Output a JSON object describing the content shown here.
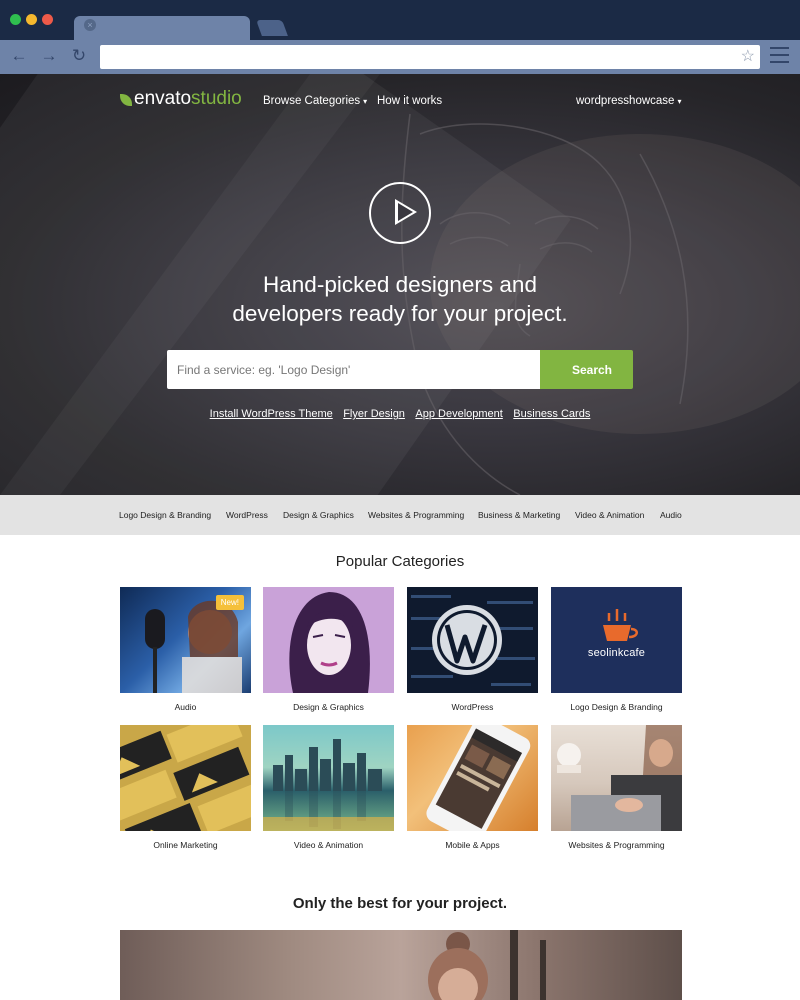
{
  "browser": {
    "tab_close_glyph": "×",
    "back_glyph": "←",
    "forward_glyph": "→",
    "reload_glyph": "↻",
    "bookmark_glyph": "☆",
    "url": ""
  },
  "header": {
    "logo_part1": "envato",
    "logo_part2": "studio",
    "nav": [
      {
        "label": "Browse Categories",
        "has_caret": true
      },
      {
        "label": "How it works",
        "has_caret": false
      }
    ],
    "account_label": "wordpresshowcase",
    "caret_glyph": "▾"
  },
  "hero": {
    "headline_line1": "Hand-picked designers and",
    "headline_line2": "developers ready for your project.",
    "search_placeholder": "Find a service: eg. 'Logo Design'",
    "search_button": "Search",
    "quick_links": [
      "Install WordPress Theme",
      "Flyer Design",
      "App Development",
      "Business Cards"
    ]
  },
  "category_bar": [
    "Logo Design & Branding",
    "WordPress",
    "Design & Graphics",
    "Websites & Programming",
    "Business & Marketing",
    "Video & Animation",
    "Audio"
  ],
  "popular": {
    "title": "Popular Categories",
    "cards": [
      {
        "label": "Audio",
        "badge": "New!"
      },
      {
        "label": "Design & Graphics",
        "badge": ""
      },
      {
        "label": "WordPress",
        "badge": ""
      },
      {
        "label": "Logo Design & Branding",
        "badge": "",
        "logo_text": "seolinkcafe"
      },
      {
        "label": "Online Marketing",
        "badge": ""
      },
      {
        "label": "Video & Animation",
        "badge": ""
      },
      {
        "label": "Mobile & Apps",
        "badge": ""
      },
      {
        "label": "Websites & Programming",
        "badge": ""
      }
    ]
  },
  "best": {
    "title": "Only the best for your project."
  },
  "colors": {
    "brand_green": "#82b541",
    "chrome_dark": "#1b2a45",
    "chrome_light": "#6e83a8",
    "badge_yellow": "#f5c03a"
  }
}
